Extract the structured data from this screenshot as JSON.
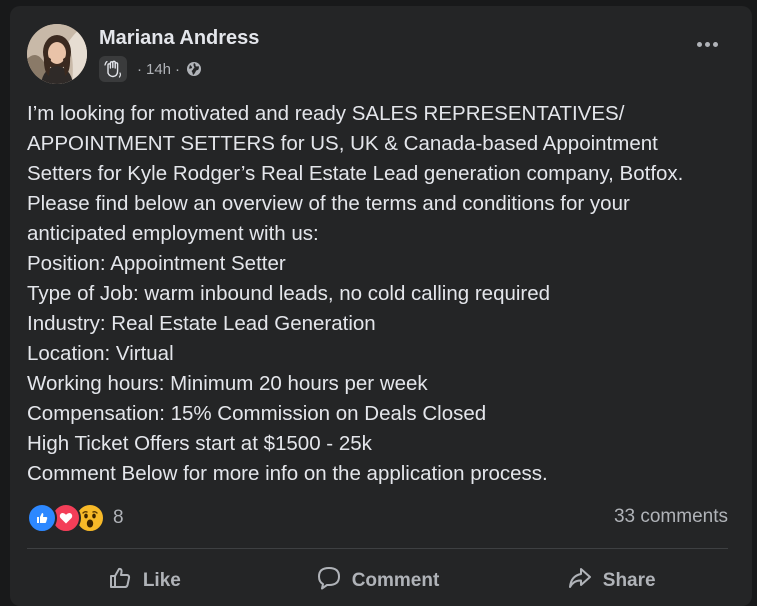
{
  "post": {
    "author": "Mariana Andress",
    "time": "14h",
    "separator": "·",
    "body_lines": [
      "I’m looking for motivated and ready SALES REPRESENTATIVES/",
      "APPOINTMENT SETTERS for US, UK & Canada-based Appointment",
      "Setters for Kyle Rodger’s Real Estate Lead generation company, Botfox.",
      "Please find below an overview of the terms and conditions for your",
      "anticipated employment with us:",
      "Position: Appointment Setter",
      "Type of Job: warm inbound leads, no cold calling required",
      "Industry: Real Estate Lead Generation",
      "Location: Virtual",
      "Working hours: Minimum 20 hours per week",
      "Compensation: 15% Commission on Deals Closed",
      "High Ticket Offers start at $1500 - 25k",
      "Comment Below for more info on the application process."
    ]
  },
  "reactions": {
    "types": [
      "like-icon",
      "love-icon",
      "wow-icon"
    ],
    "count": "8"
  },
  "comments": {
    "count_label": "33 comments"
  },
  "actions": {
    "like": "Like",
    "comment": "Comment",
    "share": "Share"
  },
  "colors": {
    "background": "#18191a",
    "card": "#242526",
    "text_primary": "#e4e6eb",
    "text_secondary": "#b0b3b8",
    "like_blue": "#2d88ff",
    "love_red": "#f33e58",
    "wow_yellow": "#f7b928"
  }
}
